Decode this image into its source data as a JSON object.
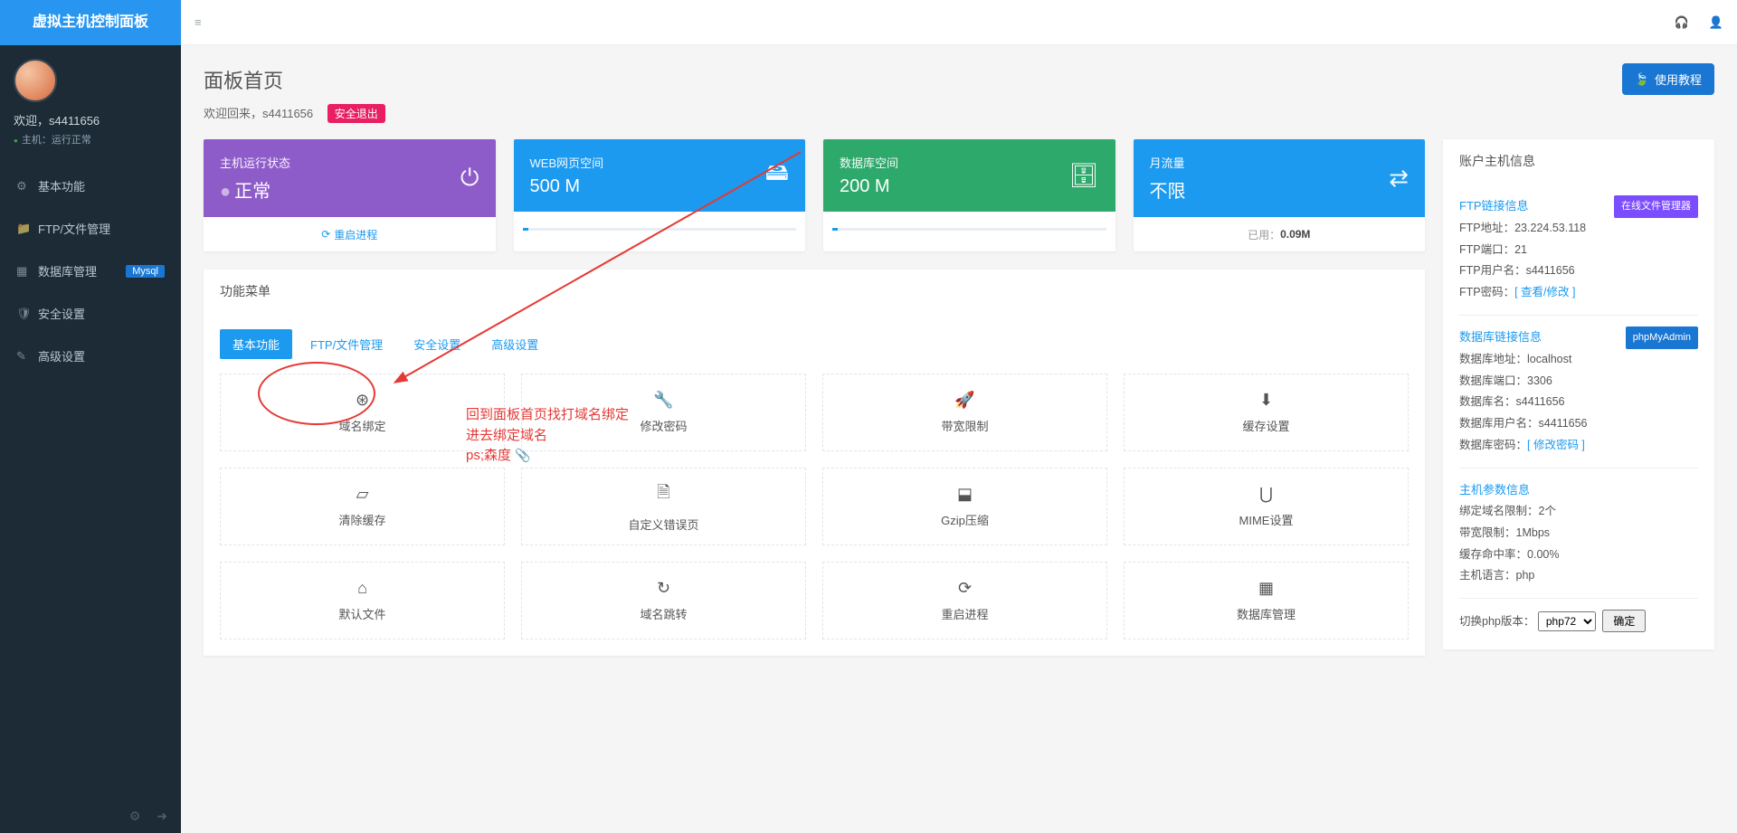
{
  "brand": "虚拟主机控制面板",
  "user": {
    "welcome": "欢迎，",
    "name": "s4411656",
    "status_label": "主机：运行正常"
  },
  "nav": {
    "items": [
      {
        "label": "基本功能",
        "badge": ""
      },
      {
        "label": "FTP/文件管理",
        "badge": ""
      },
      {
        "label": "数据库管理",
        "badge": "Mysql"
      },
      {
        "label": "安全设置",
        "badge": ""
      },
      {
        "label": "高级设置",
        "badge": ""
      }
    ]
  },
  "page": {
    "title": "面板首页",
    "welcome_back": "欢迎回来，s4411656",
    "logout_label": "安全退出",
    "tutorial_label": "使用教程"
  },
  "status_cards": [
    {
      "title": "主机运行状态",
      "value": "正常",
      "action": "重启进程",
      "color": "c-purple"
    },
    {
      "title": "WEB网页空间",
      "value": "500 M",
      "action": "",
      "color": "c-blue"
    },
    {
      "title": "数据库空间",
      "value": "200 M",
      "action": "",
      "color": "c-green"
    },
    {
      "title": "月流量",
      "value": "不限",
      "used_label": "已用：",
      "used_value": "0.09M",
      "color": "c-teal"
    }
  ],
  "menu": {
    "head": "功能菜单",
    "tabs": [
      "基本功能",
      "FTP/文件管理",
      "安全设置",
      "高级设置"
    ],
    "items": [
      "域名绑定",
      "修改密码",
      "带宽限制",
      "缓存设置",
      "清除缓存",
      "自定义错误页",
      "Gzip压缩",
      "MIME设置",
      "默认文件",
      "域名跳转",
      "重启进程",
      "数据库管理"
    ]
  },
  "info": {
    "head": "账户主机信息",
    "ftp": {
      "title": "FTP链接信息",
      "tag": "在线文件管理器",
      "addr_label": "FTP地址：",
      "addr": "23.224.53.118",
      "port_label": "FTP端口：",
      "port": "21",
      "user_label": "FTP用户名：",
      "user": "s4411656",
      "pwd_label": "FTP密码：",
      "pwd_action": "[ 查看/修改 ]"
    },
    "db": {
      "title": "数据库链接信息",
      "tag": "phpMyAdmin",
      "addr_label": "数据库地址：",
      "addr": "localhost",
      "port_label": "数据库端口：",
      "port": "3306",
      "name_label": "数据库名：",
      "name": "s4411656",
      "user_label": "数据库用户名：",
      "user": "s4411656",
      "pwd_label": "数据库密码：",
      "pwd_action": "[ 修改密码 ]"
    },
    "host": {
      "title": "主机参数信息",
      "domain_limit_label": "绑定域名限制：",
      "domain_limit": "2个",
      "bw_label": "带宽限制：",
      "bw": "1Mbps",
      "cache_label": "缓存命中率：",
      "cache": "0.00%",
      "lang_label": "主机语言：",
      "lang": "php"
    },
    "php": {
      "switch_label": "切换php版本：",
      "current": "php72",
      "ok": "确定"
    }
  },
  "annotation": {
    "line1": "回到面板首页找打域名绑定",
    "line2": "进去绑定域名",
    "line3": "ps;森度"
  }
}
